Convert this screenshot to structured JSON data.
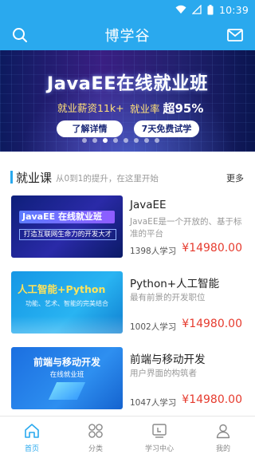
{
  "status_bar": {
    "time": "10:39"
  },
  "app_bar": {
    "title": "博学谷"
  },
  "banner": {
    "headline": "JavaEE在线就业班",
    "salary_text": "就业薪资11k+",
    "rate_label": "就业率",
    "rate_value": "超95%",
    "button_details": "了解详情",
    "button_trial": "7天免费试学",
    "dot_count": 8,
    "active_dot": 2
  },
  "section": {
    "title": "就业课",
    "subtitle": "从0到1的提升，在这里开始",
    "more": "更多"
  },
  "courses": [
    {
      "name": "JavaEE",
      "desc": "JavaEE是一个开放的、基于标准的平台",
      "learners": "1398人学习",
      "price": "¥14980.00",
      "thumb_line1": "JavaEE 在线就业班",
      "thumb_line2": "打造互联网生命力的开发大才"
    },
    {
      "name": "Python+人工智能",
      "desc": "最有前景的开发职位",
      "learners": "1002人学习",
      "price": "¥14980.00",
      "thumb_line1": "人工智能+Python",
      "thumb_line2": "功能、艺术、智能的完美结合"
    },
    {
      "name": "前端与移动开发",
      "desc": "用户界面的构筑者",
      "learners": "1047人学习",
      "price": "¥14980.00",
      "thumb_line1": "前端与移动开发",
      "thumb_line2": "在线就业班"
    }
  ],
  "tab_bar": {
    "tabs": [
      {
        "label": "首页",
        "icon": "home-icon",
        "active": true
      },
      {
        "label": "分类",
        "icon": "category-icon",
        "active": false
      },
      {
        "label": "学习中心",
        "icon": "learning-center-icon",
        "active": false
      },
      {
        "label": "我的",
        "icon": "profile-icon",
        "active": false
      }
    ]
  },
  "colors": {
    "primary": "#2aa9ee",
    "price": "#e63b2e"
  }
}
